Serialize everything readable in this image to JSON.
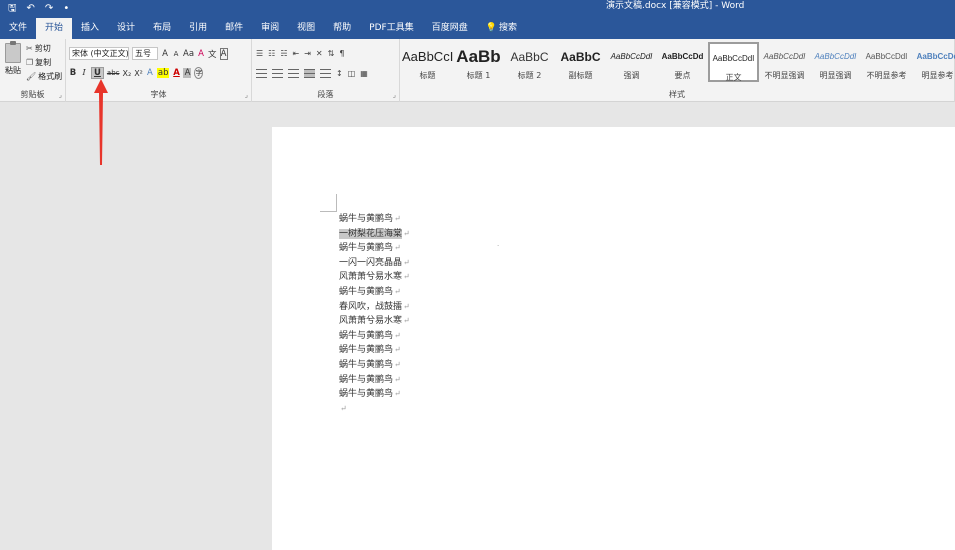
{
  "title_bar": {
    "doc_title": "演示文稿.docx [兼容模式] - Word",
    "qa_icons": [
      "save-icon",
      "undo-icon",
      "redo-icon",
      "customize-icon"
    ],
    "qa_glyphs": [
      "🖫",
      "↶",
      "↷",
      "•"
    ],
    "brand_color": "#2b579a"
  },
  "tabs": [
    {
      "label": "文件"
    },
    {
      "label": "开始",
      "active": true
    },
    {
      "label": "插入"
    },
    {
      "label": "设计"
    },
    {
      "label": "布局"
    },
    {
      "label": "引用"
    },
    {
      "label": "邮件"
    },
    {
      "label": "审阅"
    },
    {
      "label": "视图"
    },
    {
      "label": "帮助"
    },
    {
      "label": "PDF工具集"
    },
    {
      "label": "百度网盘"
    },
    {
      "label": "搜索"
    }
  ],
  "clipboard": {
    "paste": "粘贴",
    "cut": "剪切",
    "copy": "复制",
    "format_painter": "格式刷",
    "group_label": "剪贴板"
  },
  "font": {
    "font_name": "宋体 (中文正文)",
    "font_size": "五号",
    "grow": "A",
    "shrink": "A",
    "change_case": "Aa",
    "clear": "A",
    "phonetic": "文",
    "border_char": "A",
    "bold": "B",
    "italic": "I",
    "underline": "U",
    "strike": "abc",
    "sub": "X₂",
    "sup": "X²",
    "effects": "A",
    "highlight": "ab",
    "font_color": "A",
    "shading": "A",
    "enclose": "字",
    "group_label": "字体"
  },
  "paragraph": {
    "group_label": "段落"
  },
  "styles": {
    "group_label": "样式",
    "items": [
      {
        "sample": "AaBbCcI",
        "name": "标题"
      },
      {
        "sample": "AaBb",
        "name": "标题 1"
      },
      {
        "sample": "AaBbC",
        "name": "标题 2"
      },
      {
        "sample": "AaBbC",
        "name": "副标题"
      },
      {
        "sample": "AaBbCcDdI",
        "name": "强调"
      },
      {
        "sample": "AaBbCcDd",
        "name": "要点"
      },
      {
        "sample": "AaBbCcDdI",
        "name": "正文",
        "active": true
      },
      {
        "sample": "AaBbCcDdI",
        "name": "不明显强调"
      },
      {
        "sample": "AaBbCcDdI",
        "name": "明显强调"
      },
      {
        "sample": "AaBbCcDdI",
        "name": "不明显参考"
      },
      {
        "sample": "AaBbCcDd",
        "name": "明显参考"
      }
    ]
  },
  "document": {
    "lines": [
      {
        "text": "蜗牛与黄鹂鸟"
      },
      {
        "text": "一树梨花压海棠",
        "selected": true
      },
      {
        "text": "蜗牛与黄鹂鸟"
      },
      {
        "text": "一闪一闪亮晶晶"
      },
      {
        "text": "风萧萧兮易水寒"
      },
      {
        "text": "蜗牛与黄鹂鸟"
      },
      {
        "text": "春风吹，战鼓擂"
      },
      {
        "text": "风萧萧兮易水寒"
      },
      {
        "text": "蜗牛与黄鹂鸟"
      },
      {
        "text": "蜗牛与黄鹂鸟"
      },
      {
        "text": "蜗牛与黄鹂鸟"
      },
      {
        "text": "蜗牛与黄鹂鸟"
      },
      {
        "text": "蜗牛与黄鹂鸟"
      },
      {
        "text": ""
      }
    ],
    "paragraph_mark": "↵",
    "selection_color": "#c8c8c8"
  },
  "annotation": {
    "arrow_color": "#e8352b",
    "points_to": "underline-button"
  }
}
